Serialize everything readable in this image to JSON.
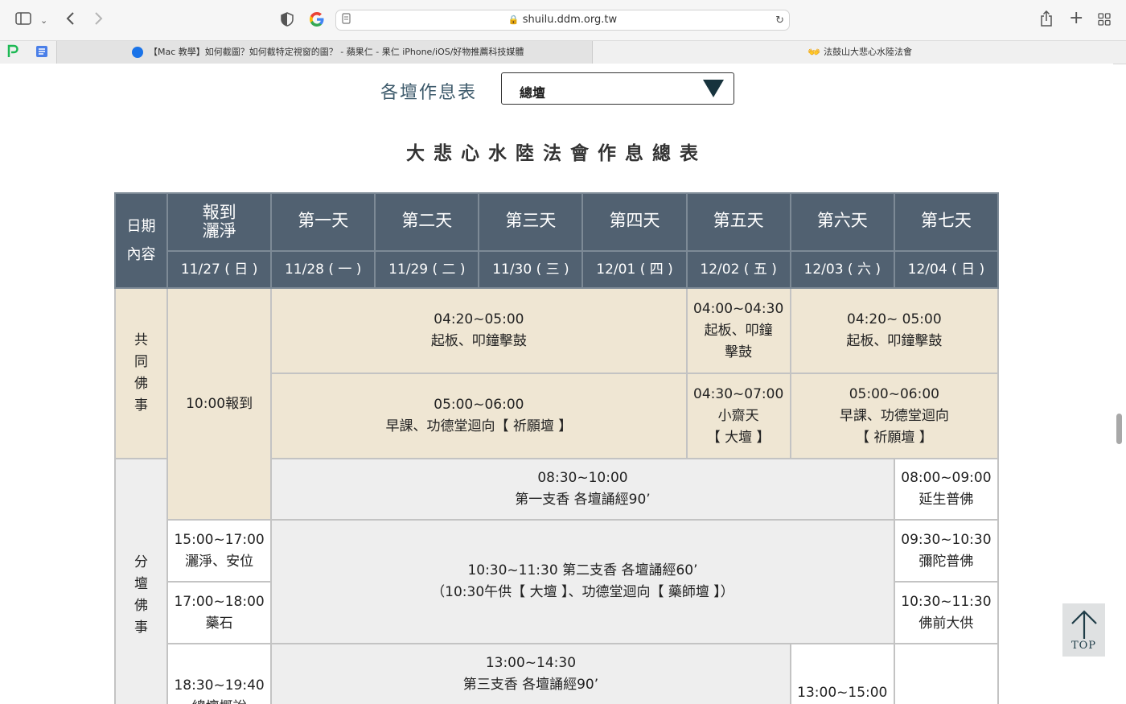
{
  "browser": {
    "url": "shuilu.ddm.org.tw",
    "tabs": [
      {
        "title": "【Mac 教學】如何截圖？如何截特定視窗的圖？ - 蘋果仁 - 果仁 iPhone/iOS/好物推薦科技媒體"
      },
      {
        "title": "法鼓山大悲心水陸法會"
      }
    ]
  },
  "page": {
    "schedule_label": "各壇作息表",
    "select_value": "總壇",
    "title": "大悲心水陸法會作息總表",
    "top_button": "TOP"
  },
  "table": {
    "corner": [
      "日期",
      "內容"
    ],
    "days": [
      {
        "name": [
          "報到",
          "灑淨"
        ],
        "date": "11/27 ( 日 )"
      },
      {
        "name": [
          "第一天"
        ],
        "date": "11/28 ( 一 )"
      },
      {
        "name": [
          "第二天"
        ],
        "date": "11/29 ( 二 )"
      },
      {
        "name": [
          "第三天"
        ],
        "date": "11/30 ( 三 )"
      },
      {
        "name": [
          "第四天"
        ],
        "date": "12/01 ( 四 )"
      },
      {
        "name": [
          "第五天"
        ],
        "date": "12/02 ( 五 )"
      },
      {
        "name": [
          "第六天"
        ],
        "date": "12/03 ( 六 )"
      },
      {
        "name": [
          "第七天"
        ],
        "date": "12/04 ( 日 )"
      }
    ],
    "sections": {
      "common": [
        "共",
        "同",
        "佛",
        "事"
      ],
      "branch": [
        "分",
        "壇",
        "佛",
        "事"
      ]
    },
    "cells": {
      "checkin": "10:00報到",
      "r1_main": [
        "04:20~05:00",
        "起板、叩鐘擊鼓"
      ],
      "r1_day5": [
        "04:00~04:30",
        "起板、叩鐘",
        "擊鼓"
      ],
      "r1_day67": [
        "04:20~ 05:00",
        "起板、叩鐘擊鼓"
      ],
      "r2_main": [
        "05:00~06:00",
        "早課、功德堂迴向【 祈願壇 】"
      ],
      "r2_day5": [
        "04:30~07:00",
        "小齋天",
        "【 大壇 】"
      ],
      "r2_day67": [
        "05:00~06:00",
        "早課、功德堂迴向",
        "【 祈願壇 】"
      ],
      "r3_main": [
        "08:30~10:00",
        "第一支香 各壇誦經90’"
      ],
      "r3_day7": [
        "08:00~09:00",
        "延生普佛"
      ],
      "r4_day0": [
        "15:00~17:00",
        "灑淨、安位"
      ],
      "r4_main": [
        "10:30~11:30 第二支香 各壇誦經60’",
        "（10:30午供【 大壇 】、功德堂迴向【 藥師壇 】）"
      ],
      "r4_day7": [
        "09:30~10:30",
        "彌陀普佛"
      ],
      "r5_day0": [
        "17:00~18:00",
        "藥石"
      ],
      "r5_day7": [
        "10:30~11:30",
        "佛前大供"
      ],
      "r6_day0": [
        "18:30~19:40",
        "總壇概說"
      ],
      "r6_main": [
        "13:00~14:30",
        "第三支香 各壇誦經90’"
      ],
      "r6_day6": [
        "13:00~15:00"
      ]
    }
  }
}
